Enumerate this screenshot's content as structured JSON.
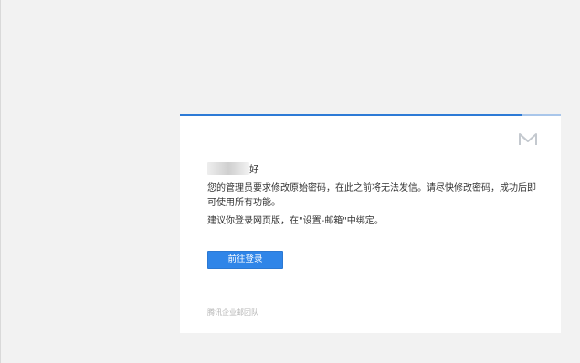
{
  "email": {
    "greeting_suffix": "好",
    "message_line1": "您的管理员要求修改原始密码，在此之前将无法发信。请尽快修改密码，成功后即可使用所有功能。",
    "message_line2": "建议你登录网页版，在\"设置-邮箱\"中绑定。",
    "login_button_label": "前往登录",
    "footer": "腾讯企业邮团队",
    "logo_icon": "tencent-exmail-logo-icon"
  },
  "progress": {
    "fraction": 0.897
  },
  "colors": {
    "accent": "#2f85e8",
    "progress_fill": "#2d7ad6",
    "progress_track": "#a9c6ea",
    "background": "#f2f2f2",
    "card": "#ffffff",
    "text": "#333333",
    "footer_text": "#b5b5b5"
  }
}
